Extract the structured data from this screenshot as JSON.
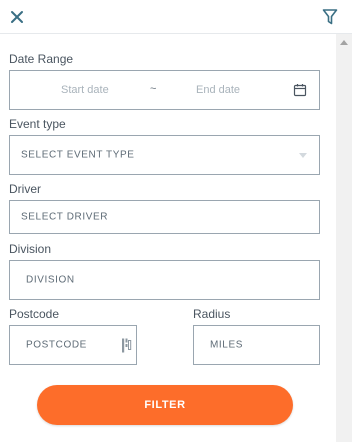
{
  "date_range": {
    "label": "Date Range",
    "start_placeholder": "Start date",
    "separator": "~",
    "end_placeholder": "End date"
  },
  "event_type": {
    "label": "Event type",
    "value": "SELECT EVENT TYPE"
  },
  "driver": {
    "label": "Driver",
    "value": "SELECT DRIVER"
  },
  "division": {
    "label": "Division",
    "value": "DIVISION"
  },
  "postcode": {
    "label": "Postcode",
    "placeholder": "POSTCODE"
  },
  "radius": {
    "label": "Radius",
    "placeholder": "MILES"
  },
  "submit_label": "FILTER",
  "icons": {
    "close": "close-icon",
    "filter": "filter-icon",
    "calendar": "calendar-icon",
    "dropdown": "chevron-down-icon",
    "autofill": "autofill-icon"
  },
  "colors": {
    "accent": "#fd6d2a",
    "icon": "#3a6f84",
    "field_border": "#9aa6b0",
    "label_text": "#4a5560"
  }
}
